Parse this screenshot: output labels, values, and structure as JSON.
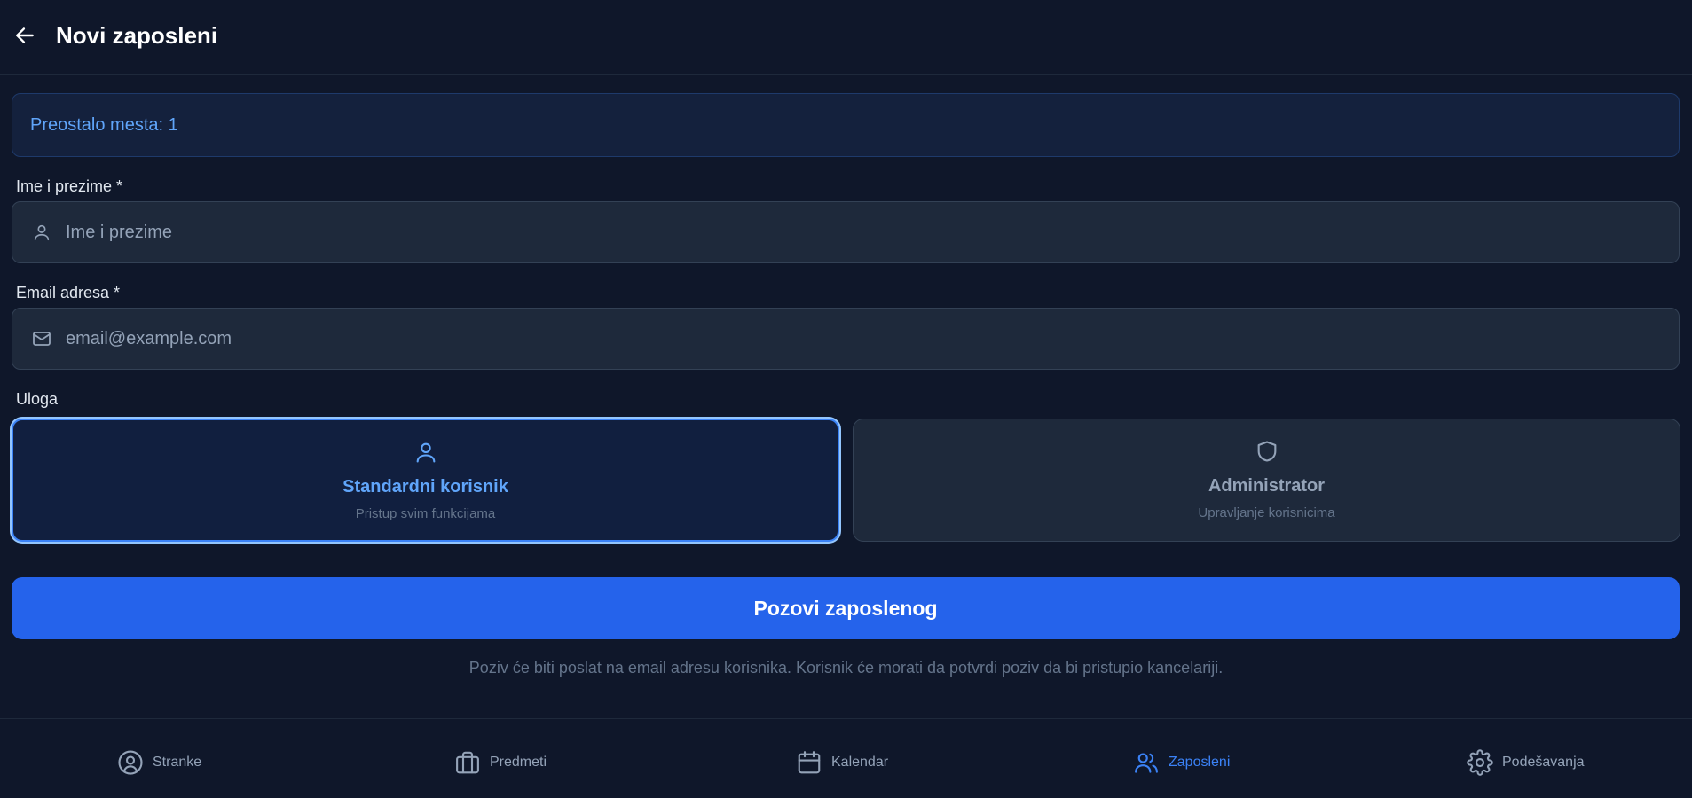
{
  "header": {
    "title": "Novi zaposleni",
    "back_icon": "arrow-left-icon"
  },
  "banner": {
    "text": "Preostalo mesta: 1"
  },
  "form": {
    "name": {
      "label": "Ime i prezime *",
      "placeholder": "Ime i prezime",
      "icon": "user-icon"
    },
    "email": {
      "label": "Email adresa *",
      "placeholder": "email@example.com",
      "icon": "mail-icon"
    },
    "role": {
      "label": "Uloga",
      "options": [
        {
          "title": "Standardni korisnik",
          "description": "Pristup svim funkcijama",
          "icon": "user-icon",
          "selected": true
        },
        {
          "title": "Administrator",
          "description": "Upravljanje korisnicima",
          "icon": "shield-icon",
          "selected": false
        }
      ]
    },
    "submit_label": "Pozovi zaposlenog",
    "hint": "Poziv će biti poslat na email adresu korisnika. Korisnik će morati da potvrdi poziv da bi pristupio kancelariji."
  },
  "nav": {
    "items": [
      {
        "label": "Stranke",
        "icon": "user-circle-icon",
        "active": false
      },
      {
        "label": "Predmeti",
        "icon": "briefcase-icon",
        "active": false
      },
      {
        "label": "Kalendar",
        "icon": "calendar-icon",
        "active": false
      },
      {
        "label": "Zaposleni",
        "icon": "users-icon",
        "active": true
      },
      {
        "label": "Podešavanja",
        "icon": "gear-icon",
        "active": false
      }
    ]
  },
  "colors": {
    "background": "#0f172a",
    "accent": "#2563eb",
    "accent_text": "#60a5fa",
    "muted": "#94a3b8"
  }
}
